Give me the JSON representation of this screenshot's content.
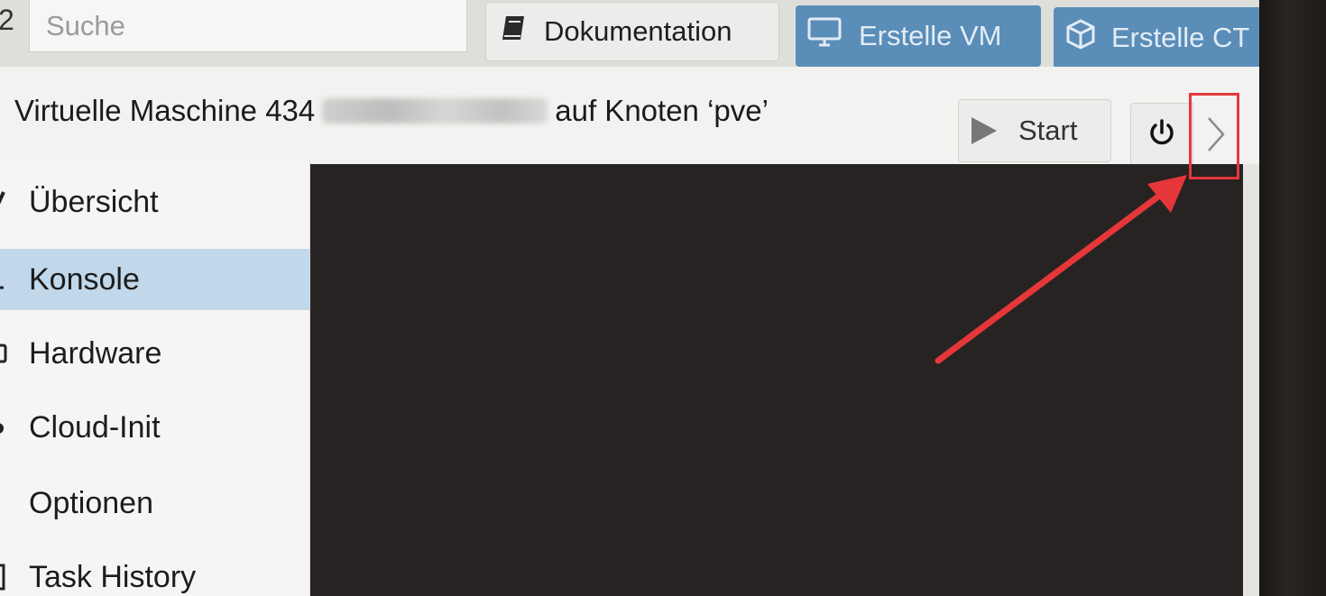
{
  "topbar": {
    "node_count": "2",
    "search_placeholder": "Suche",
    "doc_button": "Dokumentation",
    "create_vm_button": "Erstelle VM",
    "create_ct_button": "Erstelle CT"
  },
  "header": {
    "title_prefix": "Virtuelle Maschine 434",
    "title_suffix": "auf Knoten ‘pve’",
    "start_button": "Start"
  },
  "nav": {
    "items": [
      {
        "label": "Übersicht",
        "icon": "summary-icon",
        "active": false
      },
      {
        "label": "Konsole",
        "icon": "console-icon",
        "active": true
      },
      {
        "label": "Hardware",
        "icon": "hardware-icon",
        "active": false
      },
      {
        "label": "Cloud-Init",
        "icon": "cloud-icon",
        "active": false
      },
      {
        "label": "Optionen",
        "icon": "gear-icon",
        "active": false
      },
      {
        "label": "Task History",
        "icon": "list-icon",
        "active": false
      }
    ]
  },
  "colors": {
    "accent": "#5a8db8",
    "active_nav": "#c1d7ea",
    "console_bg": "#262322",
    "annotation": "#e5373a"
  }
}
